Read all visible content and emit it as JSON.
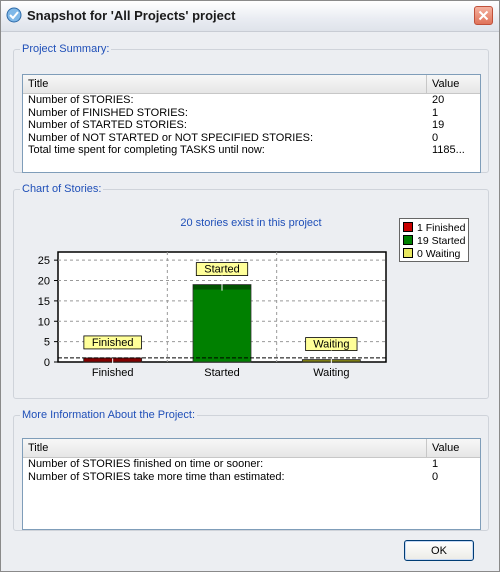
{
  "window": {
    "title": "Snapshot for 'All Projects' project"
  },
  "summary": {
    "legend": "Project Summary:",
    "columns": [
      "Title",
      "Value"
    ],
    "rows": [
      {
        "title": "Number of STORIES:",
        "value": "20"
      },
      {
        "title": "Number of FINISHED STORIES:",
        "value": "1"
      },
      {
        "title": "Number of STARTED STORIES:",
        "value": "19"
      },
      {
        "title": "Number of NOT STARTED or NOT SPECIFIED STORIES:",
        "value": "0"
      },
      {
        "title": "Total time spent for completing TASKS until now:",
        "value": "1185..."
      }
    ]
  },
  "chart_section": {
    "legend": "Chart of Stories:"
  },
  "chart_data": {
    "type": "bar",
    "title": "20 stories exist in this project",
    "categories": [
      "Finished",
      "Started",
      "Waiting"
    ],
    "values": [
      1,
      19,
      0
    ],
    "bar_labels": [
      "Finished",
      "Started",
      "Waiting"
    ],
    "colors": [
      "#c80000",
      "#008000",
      "#c0c020"
    ],
    "ylim": [
      0,
      27
    ],
    "yticks": [
      "0",
      "5",
      "10",
      "15",
      "20",
      "25"
    ],
    "ytick_values": [
      0,
      5,
      10,
      15,
      20,
      25
    ],
    "grid": true,
    "legend_position": "top-right",
    "legend": [
      "1 Finished",
      "19 Started",
      "0 Waiting"
    ]
  },
  "more_info": {
    "legend": "More Information About the Project:",
    "columns": [
      "Title",
      "Value"
    ],
    "rows": [
      {
        "title": "Number of STORIES finished on time or sooner:",
        "value": "1"
      },
      {
        "title": "Number of STORIES take more time than estimated:",
        "value": "0"
      }
    ]
  },
  "buttons": {
    "ok": "OK"
  }
}
